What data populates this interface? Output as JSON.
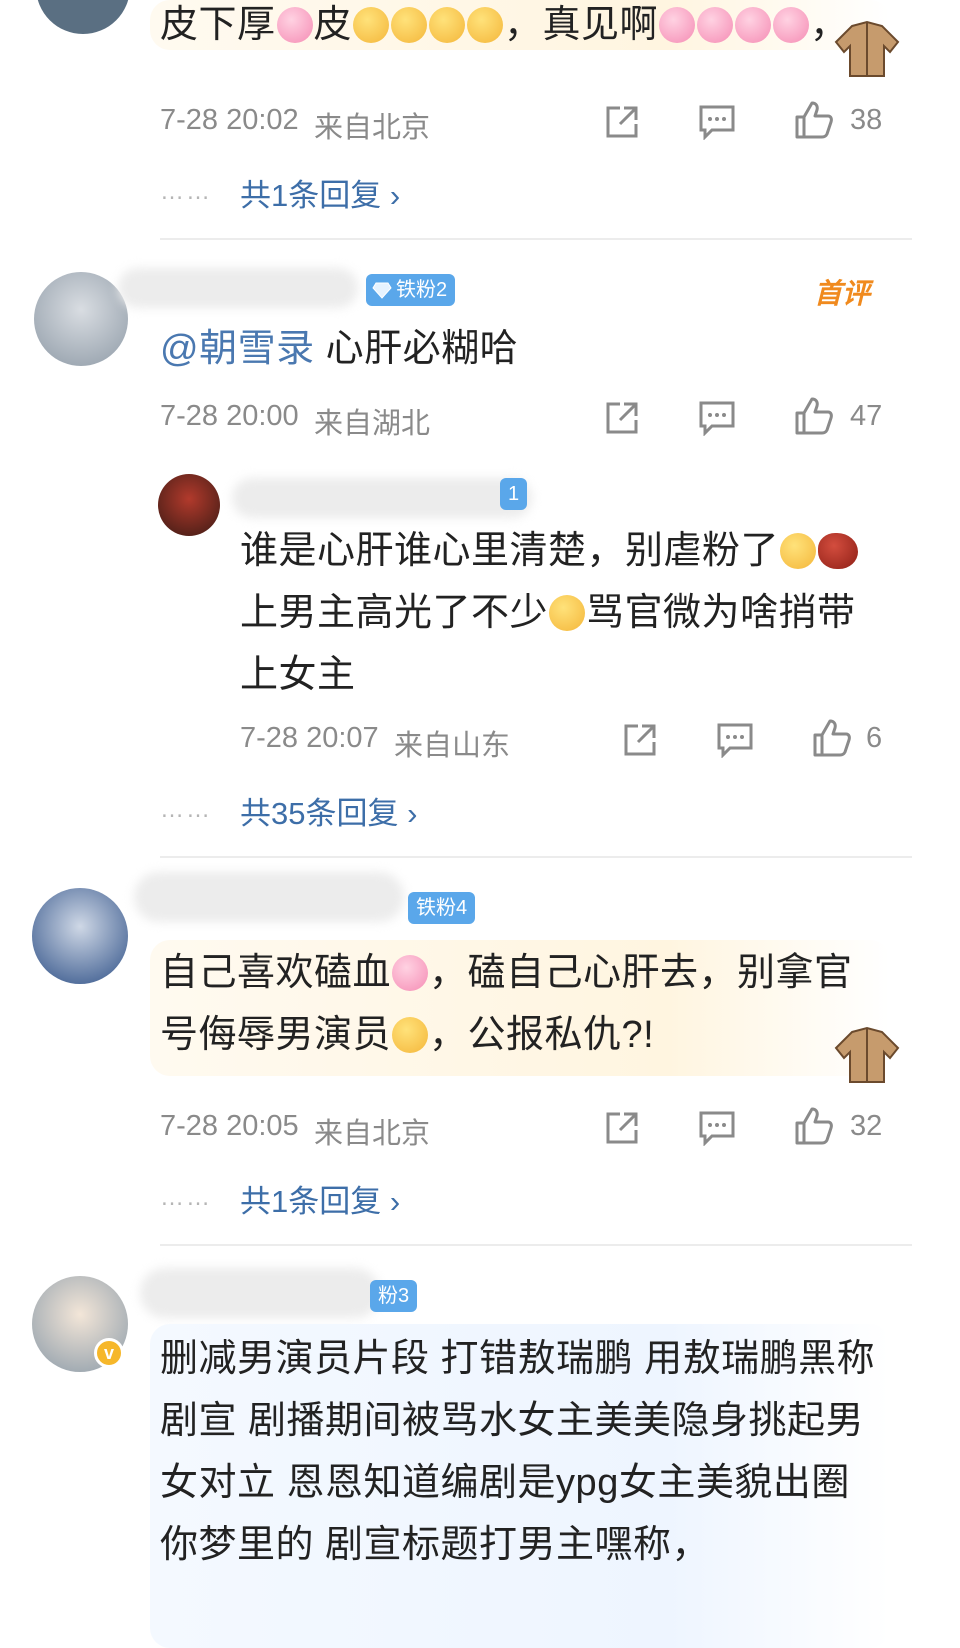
{
  "comments": [
    {
      "text_parts": [
        "皮下厚",
        "皮",
        "，真见啊",
        "，"
      ],
      "time": "7-28 20:02",
      "location": "来自北京",
      "likes": "38",
      "replies": "共1条回复 ›"
    },
    {
      "badge": "铁粉2",
      "first_comment_label": "首评",
      "mention": "@朝雪录",
      "text": "心肝必糊哈",
      "time": "7-28 20:00",
      "location": "来自湖北",
      "likes": "47",
      "reply": {
        "badge": "1",
        "lines": [
          "谁是心肝谁心里清楚，别虐粉了",
          "上男主高光了不少",
          "骂官微为啥捎带",
          "上女主"
        ],
        "time": "7-28 20:07",
        "location": "来自山东",
        "likes": "6"
      },
      "replies": "共35条回复 ›"
    },
    {
      "badge": "铁粉4",
      "lines": [
        "自己喜欢磕血",
        "，磕自己心肝去，别拿官",
        "号侮辱男演员",
        "，公报私仇?!"
      ],
      "time": "7-28 20:05",
      "location": "来自北京",
      "likes": "32",
      "replies": "共1条回复 ›"
    },
    {
      "badge": "粉3",
      "lines": [
        "删减男演员片段 打错敖瑞鹏 用敖瑞鹏黑称",
        "剧宣 剧播期间被骂水女主美美隐身挑起男",
        "女对立 恩恩知道编剧是ypg女主美貌出圈",
        "你梦里的 剧宣标题打男主嘿称，"
      ]
    }
  ],
  "ellipsis": "……",
  "verified_mark": "v"
}
